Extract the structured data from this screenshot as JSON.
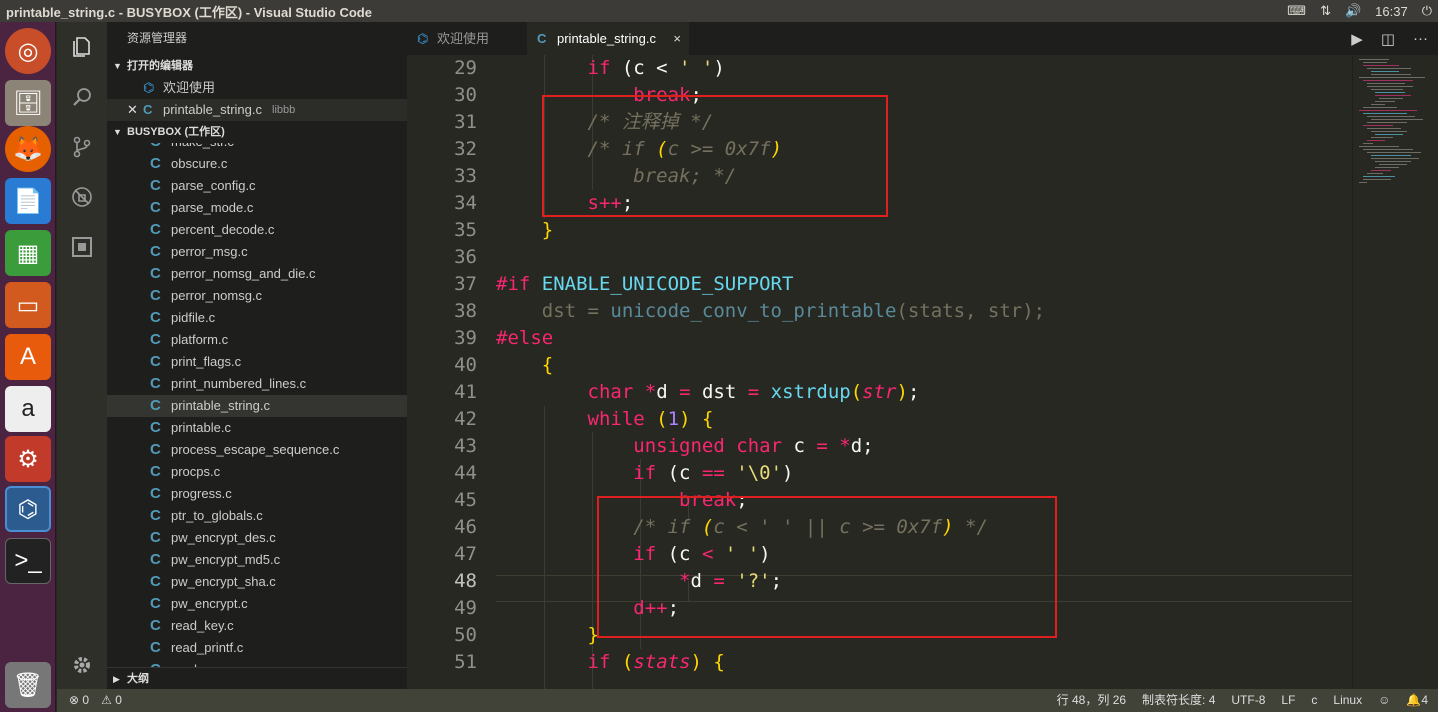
{
  "window": {
    "title": "printable_string.c - BUSYBOX (工作区) - Visual Studio Code",
    "clock": "16:37"
  },
  "launcher": [
    "ubuntu-dash",
    "files",
    "firefox",
    "writer",
    "calc",
    "impress",
    "software-center",
    "amazon",
    "system-settings",
    "vscode",
    "terminal",
    "trash"
  ],
  "sidebar": {
    "title": "资源管理器",
    "open_editors_label": "打开的编辑器",
    "open_editors": [
      {
        "name": "欢迎使用",
        "detail": ""
      },
      {
        "name": "printable_string.c",
        "detail": "libbb"
      }
    ],
    "workspace_label": "BUSYBOX (工作区)",
    "files": [
      "make_str.c",
      "obscure.c",
      "parse_config.c",
      "parse_mode.c",
      "percent_decode.c",
      "perror_msg.c",
      "perror_nomsg_and_die.c",
      "perror_nomsg.c",
      "pidfile.c",
      "platform.c",
      "print_flags.c",
      "print_numbered_lines.c",
      "printable_string.c",
      "printable.c",
      "process_escape_sequence.c",
      "procps.c",
      "progress.c",
      "ptr_to_globals.c",
      "pw_encrypt_des.c",
      "pw_encrypt_md5.c",
      "pw_encrypt_sha.c",
      "pw_encrypt.c",
      "read_key.c",
      "read_printf.c",
      "read.c"
    ],
    "outline_label": "大纲"
  },
  "tabs": [
    {
      "label": "欢迎使用",
      "active": false
    },
    {
      "label": "printable_string.c",
      "active": true,
      "close": "×"
    }
  ],
  "editor": {
    "line_numbers": [
      "29",
      "30",
      "31",
      "32",
      "33",
      "34",
      "35",
      "36",
      "37",
      "38",
      "39",
      "40",
      "41",
      "42",
      "43",
      "44",
      "45",
      "46",
      "47",
      "48",
      "49",
      "50",
      "51"
    ],
    "current_line": "48"
  },
  "status": {
    "errors": "0",
    "warnings": "0",
    "position": "行 48，列 26",
    "tab_size": "制表符长度: 4",
    "encoding": "UTF-8",
    "eol": "LF",
    "language": "c",
    "platform": "Linux",
    "notifications": "4"
  },
  "colors": {
    "editor_bg": "#272822",
    "keyword": "#f92672",
    "type": "#66d9ef",
    "string": "#e6db74",
    "comment": "#75715e",
    "highlight_box": "#e02020"
  }
}
